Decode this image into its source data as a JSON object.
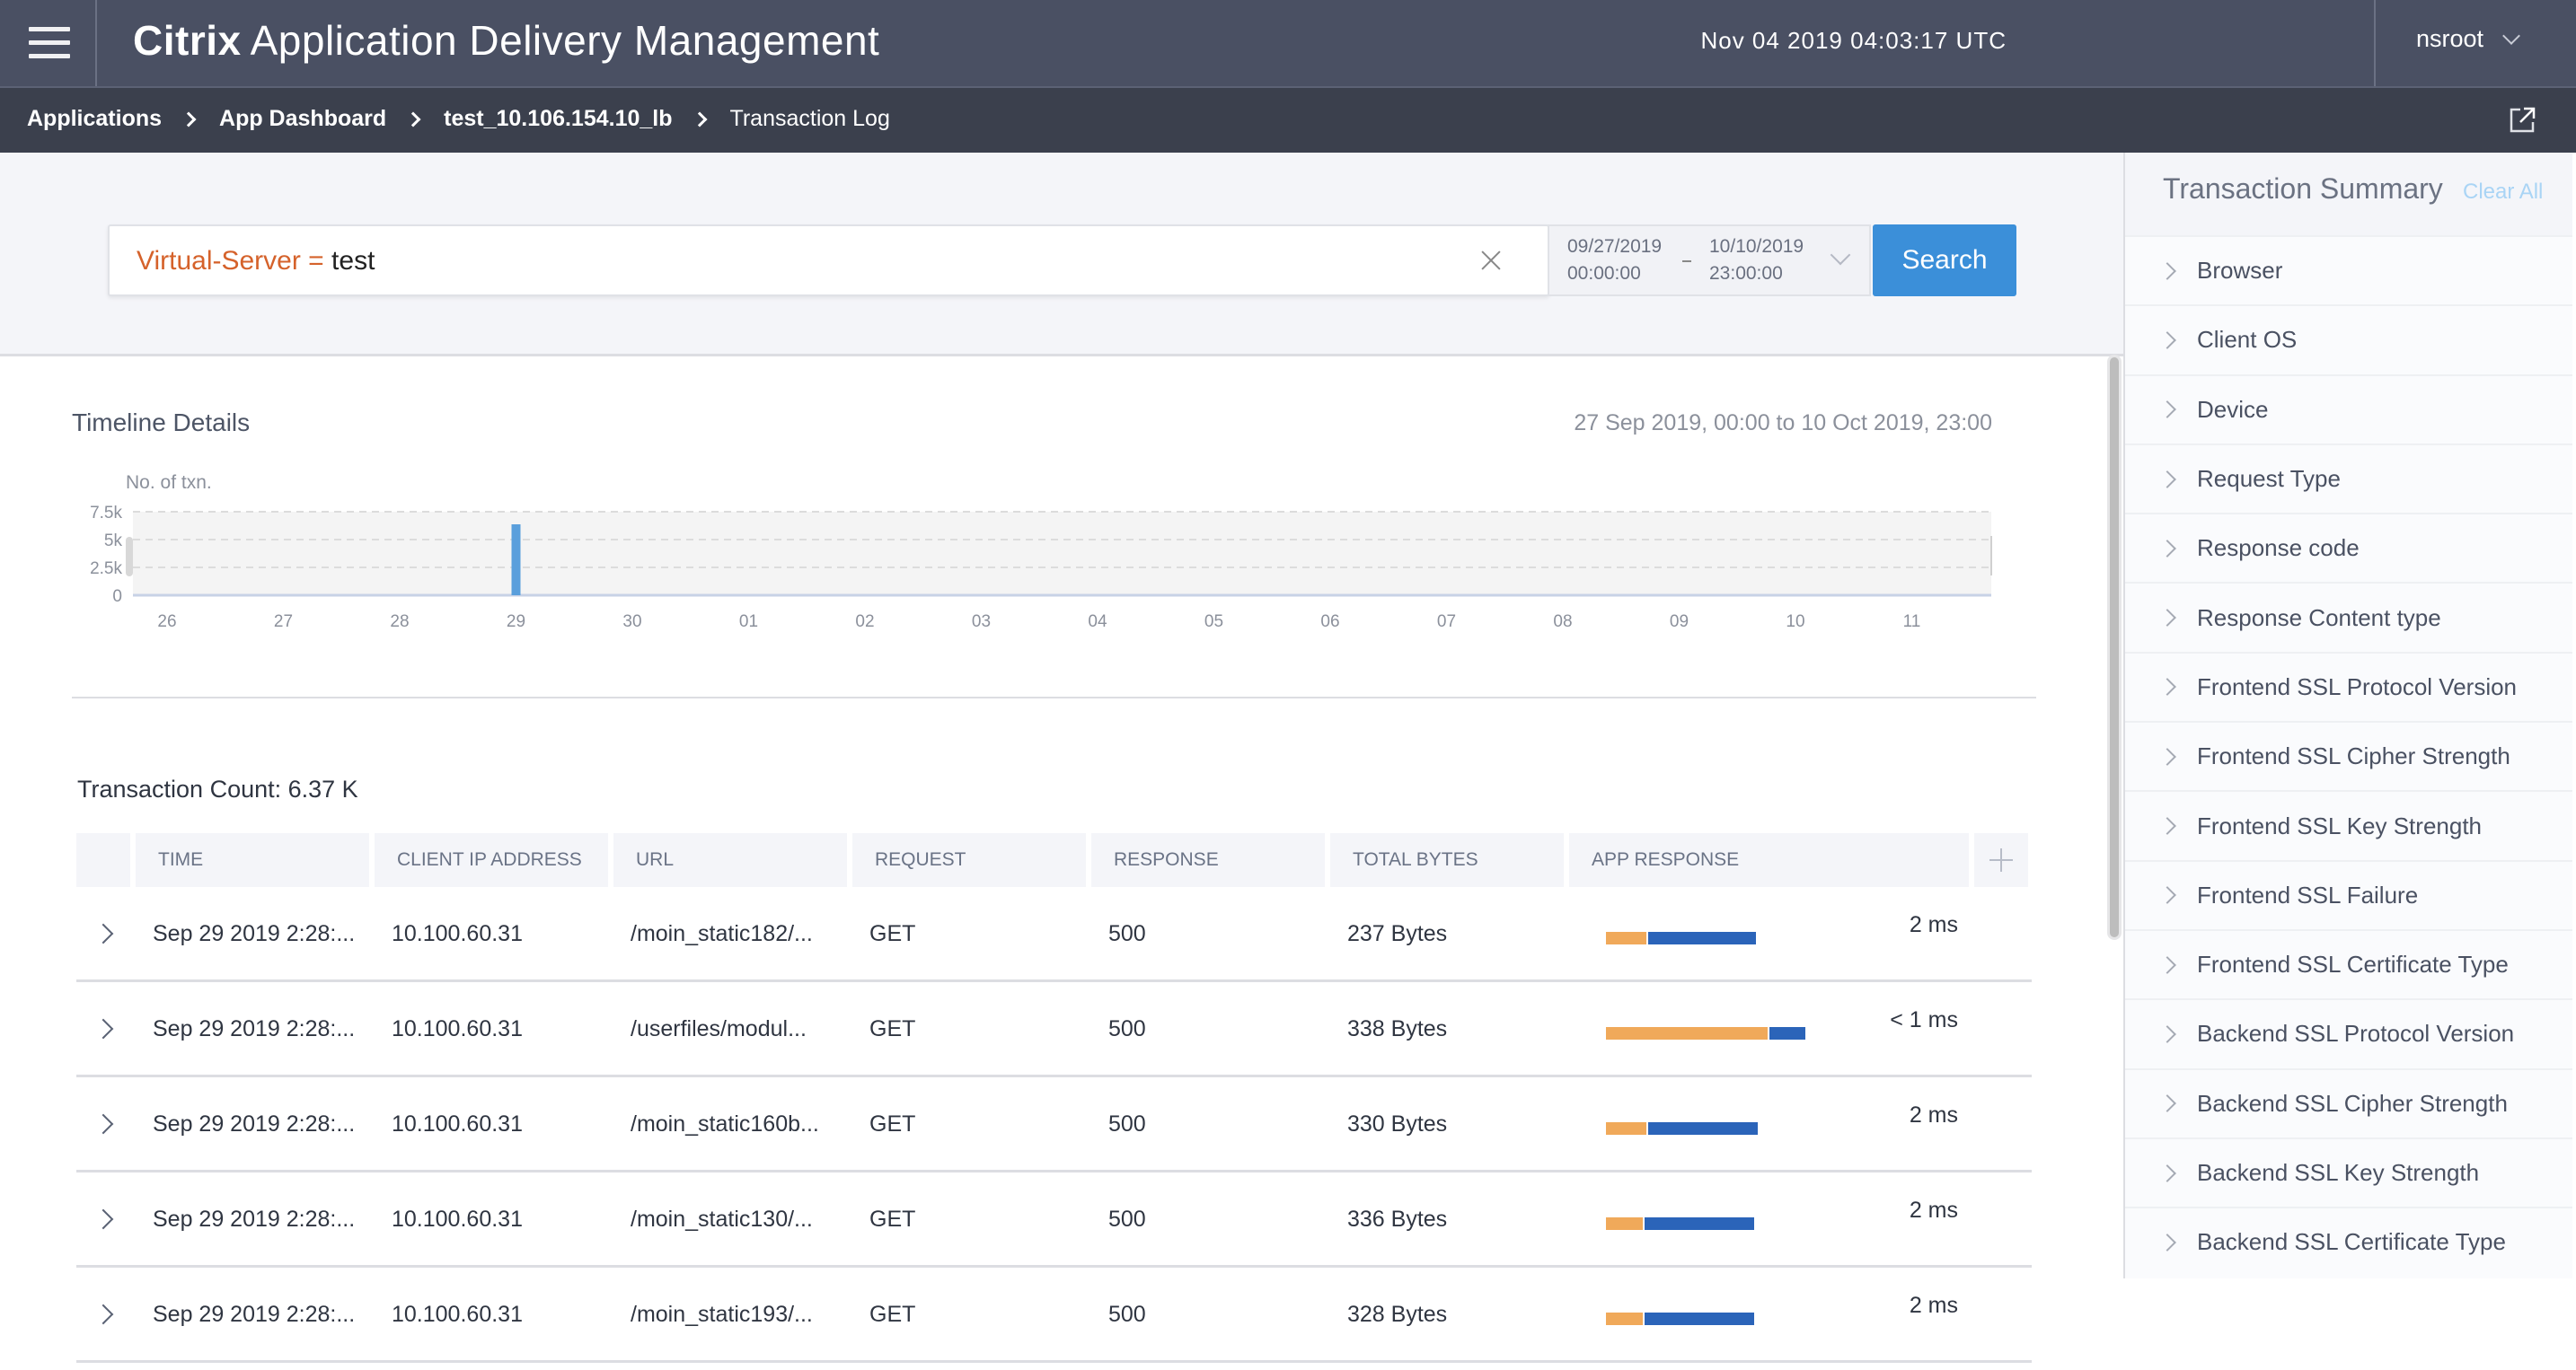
{
  "header": {
    "brand": "Citrix",
    "product": "Application Delivery Management",
    "datetime": "Nov 04 2019 04:03:17 UTC",
    "user": "nsroot",
    "menu_icon": "hamburger-menu-icon",
    "user_menu_icon": "chevron-down-icon"
  },
  "breadcrumb": {
    "items": [
      {
        "label": "Applications"
      },
      {
        "label": "App Dashboard"
      },
      {
        "label": "test_10.106.154.10_lb"
      },
      {
        "label": "Transaction Log"
      }
    ],
    "popout_icon": "external-link-icon"
  },
  "search": {
    "filter_key": "Virtual-Server =",
    "filter_value": "test",
    "clear_icon": "close-icon",
    "date_from": "09/27/2019",
    "time_from": "00:00:00",
    "date_to": "10/10/2019",
    "time_to": "23:00:00",
    "button_label": "Search",
    "accent_color": "#3b8fd9",
    "filter_key_color": "#d5622b"
  },
  "timeline": {
    "title": "Timeline Details",
    "range_text": "27 Sep 2019, 00:00 to 10 Oct 2019, 23:00"
  },
  "chart_data": {
    "type": "bar",
    "title": "Timeline Details",
    "ylabel": "No. of txn.",
    "xlabel": "",
    "categories": [
      "26",
      "27",
      "28",
      "29",
      "30",
      "01",
      "02",
      "03",
      "04",
      "05",
      "06",
      "07",
      "08",
      "09",
      "10",
      "11"
    ],
    "values": [
      0,
      0,
      0,
      6370,
      0,
      0,
      0,
      0,
      0,
      0,
      0,
      0,
      0,
      0,
      0,
      0
    ],
    "y_ticks": [
      "0",
      "2.5k",
      "5k",
      "7.5k"
    ],
    "y_tick_values": [
      0,
      2500,
      5000,
      7500
    ],
    "ylim": [
      0,
      7500
    ],
    "grid": true,
    "bar_color": "#5a9fdc",
    "legend": "none"
  },
  "table": {
    "count_label": "Transaction Count: 6.37 K",
    "columns": [
      "TIME",
      "CLIENT IP ADDRESS",
      "URL",
      "REQUEST",
      "RESPONSE",
      "TOTAL BYTES",
      "APP RESPONSE"
    ],
    "add_column_icon": "plus-icon",
    "rows": [
      {
        "time": "Sep 29 2019 2:28:...",
        "client_ip": "10.100.60.31",
        "url": "/moin_static182/...",
        "request": "GET",
        "response": "500",
        "total_bytes": "237 Bytes",
        "app_response": "2 ms",
        "bar_split": [
          0.27,
          0.73
        ],
        "bar_scale": 0.75
      },
      {
        "time": "Sep 29 2019 2:28:...",
        "client_ip": "10.100.60.31",
        "url": "/userfiles/modul...",
        "request": "GET",
        "response": "500",
        "total_bytes": "338 Bytes",
        "app_response": "< 1 ms",
        "bar_split": [
          0.82,
          0.18
        ],
        "bar_scale": 1.0
      },
      {
        "time": "Sep 29 2019 2:28:...",
        "client_ip": "10.100.60.31",
        "url": "/moin_static160b...",
        "request": "GET",
        "response": "500",
        "total_bytes": "330 Bytes",
        "app_response": "2 ms",
        "bar_split": [
          0.27,
          0.73
        ],
        "bar_scale": 0.76
      },
      {
        "time": "Sep 29 2019 2:28:...",
        "client_ip": "10.100.60.31",
        "url": "/moin_static130/...",
        "request": "GET",
        "response": "500",
        "total_bytes": "336 Bytes",
        "app_response": "2 ms",
        "bar_split": [
          0.25,
          0.75
        ],
        "bar_scale": 0.74
      },
      {
        "time": "Sep 29 2019 2:28:...",
        "client_ip": "10.100.60.31",
        "url": "/moin_static193/...",
        "request": "GET",
        "response": "500",
        "total_bytes": "328 Bytes",
        "app_response": "2 ms",
        "bar_split": [
          0.25,
          0.75
        ],
        "bar_scale": 0.74
      }
    ],
    "bar_colors": {
      "client": "#f0a95a",
      "server": "#2b64b9"
    }
  },
  "sidebar": {
    "title": "Transaction Summary",
    "clear_all": "Clear All",
    "items": [
      {
        "label": "Browser"
      },
      {
        "label": "Client OS"
      },
      {
        "label": "Device"
      },
      {
        "label": "Request Type"
      },
      {
        "label": "Response code"
      },
      {
        "label": "Response Content type"
      },
      {
        "label": "Frontend SSL Protocol Version"
      },
      {
        "label": "Frontend SSL Cipher Strength"
      },
      {
        "label": "Frontend SSL Key Strength"
      },
      {
        "label": "Frontend SSL Failure"
      },
      {
        "label": "Frontend SSL Certificate Type"
      },
      {
        "label": "Backend SSL Protocol Version"
      },
      {
        "label": "Backend SSL Cipher Strength"
      },
      {
        "label": "Backend SSL Key Strength"
      },
      {
        "label": "Backend SSL Certificate Type"
      }
    ]
  }
}
